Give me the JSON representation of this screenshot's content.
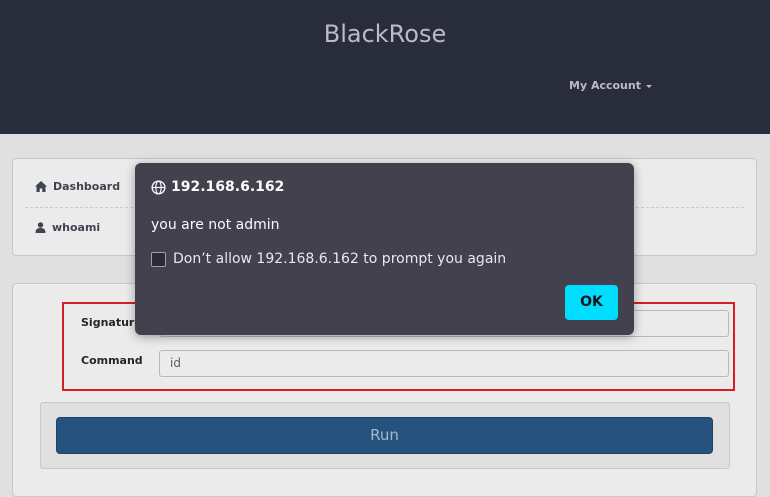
{
  "header": {
    "brand": "BlackRose",
    "account_label": "My Account"
  },
  "sidebar": {
    "items": [
      {
        "label": "Dashboard",
        "icon": "home-icon"
      },
      {
        "label": "whoami",
        "icon": "user-icon"
      }
    ]
  },
  "form": {
    "signature_label": "Signature",
    "signature_value": "",
    "command_label": "Command",
    "command_value": "id",
    "run_label": "Run"
  },
  "dialog": {
    "title": "192.168.6.162",
    "message": "you are not admin",
    "checkbox_label": "Don’t allow 192.168.6.162 to prompt you again",
    "checkbox_checked": false,
    "ok_label": "OK",
    "icon": "globe-icon"
  },
  "colors": {
    "navbar": "#2c3040",
    "run_button": "#2a5a8a",
    "dialog_bg": "#42414d",
    "ok_button": "#00ddff",
    "highlight": "#e8212b"
  }
}
